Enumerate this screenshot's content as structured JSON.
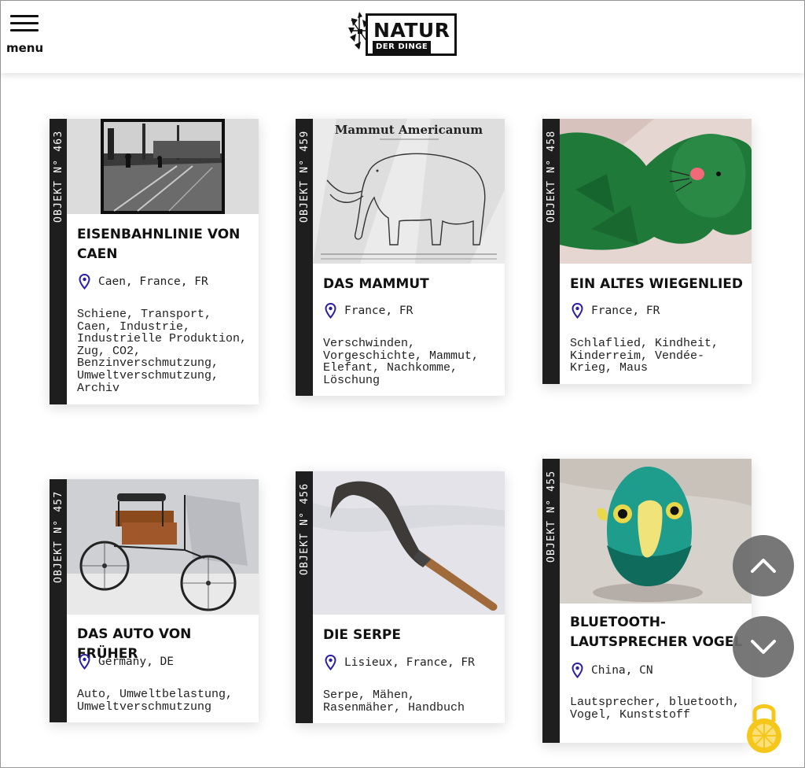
{
  "header": {
    "menu_label": "menu",
    "logo_title": "NATUR",
    "logo_subtitle": "DER DINGE"
  },
  "cards": [
    {
      "objekt": "OBJEKT N° 463",
      "title": "EISENBAHNLINIE VON CAEN",
      "location": "Caen, France, FR",
      "tags": "Schiene, Transport, Caen, Industrie, Industrielle Produktion, Zug, CO2, Benzinverschmutzung, Umweltverschmutzung, Archiv",
      "image": "railway-archive-photo"
    },
    {
      "objekt": "OBJEKT N° 459",
      "title": "DAS MAMMUT",
      "location": "France, FR",
      "tags": "Verschwinden, Vorgeschichte, Mammut, Elefant, Nachkomme, Löschung",
      "image": "mammoth-drawing",
      "image_caption": "Mammut Americanum"
    },
    {
      "objekt": "OBJEKT N° 458",
      "title": "EIN ALTES WIEGENLIED",
      "location": "France, FR",
      "tags": "Schlaflied, Kindheit, Kinderreim, Vendée-Krieg, Maus",
      "image": "green-mouse-illustration"
    },
    {
      "objekt": "OBJEKT N° 457",
      "title": "DAS AUTO VON FRÜHER",
      "location": "Germany, DE",
      "tags": "Auto, Umweltbelastung, Umweltverschmutzung",
      "image": "vintage-car-photo"
    },
    {
      "objekt": "OBJEKT N° 456",
      "title": "DIE SERPE",
      "location": "Lisieux, France, FR",
      "tags": "Serpe, Mähen, Rasenmäher, Handbuch",
      "image": "billhook-photo"
    },
    {
      "objekt": "OBJEKT N° 455",
      "title": "BLUETOOTH-LAUTSPRECHER VOGEL",
      "location": "China, CN",
      "tags": "Lautsprecher, bluetooth, Vogel, Kunststoff",
      "image": "bird-speaker-photo"
    }
  ],
  "colors": {
    "accent": "#2a1fa3",
    "side_strip": "#1e1e1e",
    "scroll_button": "#6c6c6c",
    "lock": "#f5c71a"
  },
  "icons": [
    "menu-icon",
    "location-pin-icon",
    "chevron-up-icon",
    "chevron-down-icon",
    "lock-icon"
  ]
}
